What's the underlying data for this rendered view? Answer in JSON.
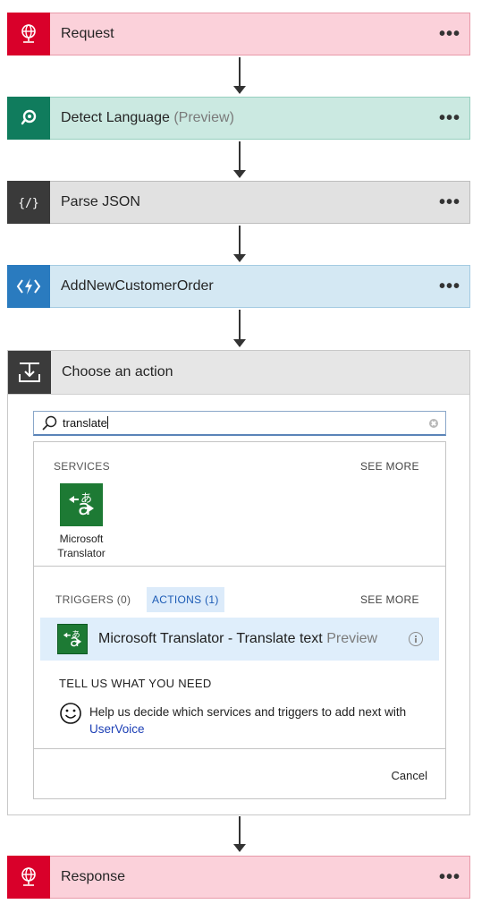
{
  "steps": {
    "request": {
      "title": "Request",
      "color": "#d9002a",
      "bg": "#fbd1da",
      "border": "#e89aa9"
    },
    "detect": {
      "title": "Detect Language",
      "sub": "(Preview)",
      "color": "#107c5d",
      "bg": "#cbe9e1",
      "border": "#97cfbf"
    },
    "parse": {
      "title": "Parse JSON",
      "color": "#3a3a3a",
      "bg": "#e1e1e1",
      "border": "#bdbdbd"
    },
    "addorder": {
      "title": "AddNewCustomerOrder",
      "color": "#2a7bbf",
      "bg": "#d4e8f3",
      "border": "#a4cbe2"
    },
    "response": {
      "title": "Response",
      "color": "#d9002a",
      "bg": "#fbd1da",
      "border": "#e89aa9"
    }
  },
  "menu_glyph": "•••",
  "choose": {
    "title": "Choose an action",
    "search_value": "translate",
    "services_label": "SERVICES",
    "see_more": "SEE MORE",
    "service_name": "Microsoft Translator",
    "triggers_tab": "TRIGGERS (0)",
    "actions_tab": "ACTIONS (1)",
    "action_title": "Microsoft Translator - Translate text",
    "action_badge": "Preview",
    "tell_us": "TELL US WHAT YOU NEED",
    "help_text": "Help us decide which services and triggers to add next with",
    "help_link": "UserVoice",
    "cancel": "Cancel"
  },
  "icons": {
    "request": "globe-request-icon",
    "detect": "detect-language-icon",
    "parse": "braces-icon",
    "addorder": "azure-function-icon",
    "choose": "insert-action-icon",
    "search": "search-icon",
    "translator": "translator-icon",
    "smile": "smiley-icon",
    "info": "info-icon"
  }
}
